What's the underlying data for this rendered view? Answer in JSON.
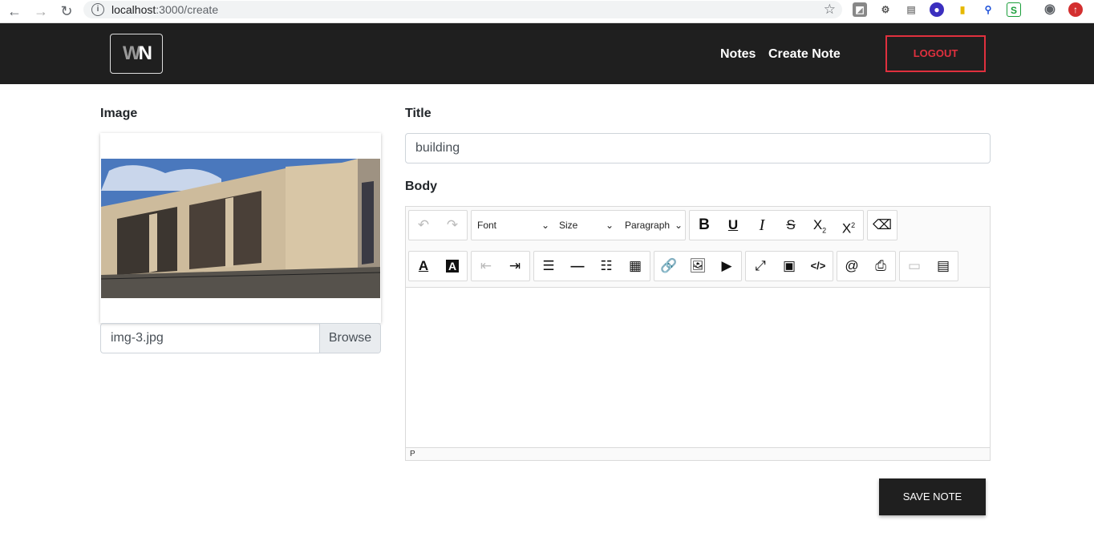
{
  "browser": {
    "url_host": "localhost",
    "url_path": ":3000/create",
    "info_icon": "info-icon",
    "star_icon": "bookmark-star-icon"
  },
  "header": {
    "logo_w": "W",
    "logo_n": "N",
    "nav": [
      "Notes",
      "Create Note"
    ],
    "logout_label": "LOGOUT",
    "accent_color": "#e0303e"
  },
  "form": {
    "image_label": "Image",
    "file_name": "img-3.jpg",
    "browse_label": "Browse",
    "title_label": "Title",
    "title_value": "building",
    "body_label": "Body",
    "save_label": "SAVE NOTE"
  },
  "editor": {
    "font_select": "Font",
    "size_select": "Size",
    "paragraph_select": "Paragraph",
    "status_path": "P"
  }
}
